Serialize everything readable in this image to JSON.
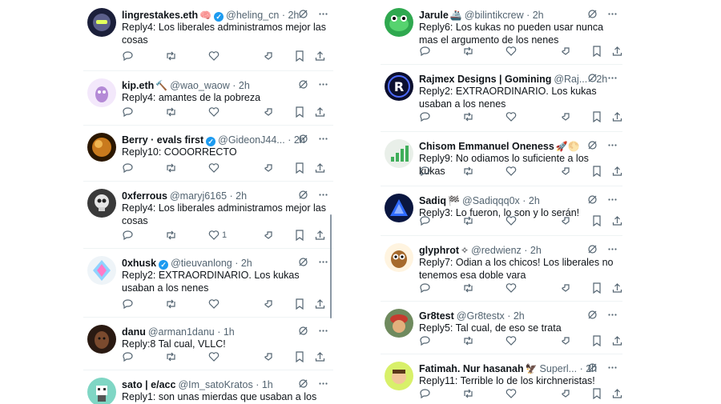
{
  "left_column": [
    {
      "name": "lingrestakes.eth",
      "emoji": "🧠",
      "verified": true,
      "handle": "@heling_cn",
      "time": "2h",
      "text": "Reply4: Los liberales administramos mejor las cosas",
      "likes": "",
      "avatar": "robot-avatar"
    },
    {
      "name": "kip.eth",
      "emoji": "🔨",
      "verified": false,
      "handle": "@wao_waow",
      "time": "2h",
      "text": "Reply4: amantes de la pobreza",
      "likes": "",
      "avatar": "purple-character-avatar"
    },
    {
      "name": "Berry · evals first",
      "emoji": "",
      "verified": true,
      "handle": "@GideonJ44...",
      "time": "2h",
      "text": "Reply10: COOORRECTO",
      "likes": "",
      "avatar": "planet-avatar"
    },
    {
      "name": "0xferrous",
      "emoji": "",
      "verified": false,
      "handle": "@maryj6165",
      "time": "2h",
      "text": "Reply4: Los liberales administramos mejor las cosas",
      "likes": "1",
      "avatar": "skull-avatar"
    },
    {
      "name": "0xhusk",
      "emoji": "",
      "verified": true,
      "handle": "@tieuvanlong",
      "time": "2h",
      "text": "Reply2: EXTRAORDINARIO. Los kukas usaban a los nenes",
      "likes": "",
      "avatar": "neon-face-avatar"
    },
    {
      "name": "danu",
      "emoji": "",
      "verified": false,
      "handle": "@arman1danu",
      "time": "1h",
      "text": "Reply:8 Tal cual, VLLC!",
      "likes": "",
      "avatar": "woman-portrait-avatar"
    },
    {
      "name": "sato | e/acc",
      "emoji": "",
      "verified": false,
      "handle": "@Im_satoKratos",
      "time": "1h",
      "text": "Reply1: son unas mierdas que usaban a los",
      "likes": "",
      "avatar": "pixel-robot-avatar"
    }
  ],
  "right_column": [
    {
      "name": "Jarule",
      "emoji": "🚢",
      "verified": false,
      "handle": "@bilintikcrew",
      "time": "2h",
      "text": "Reply6: Los kukas no pueden usar nunca mas el argumento de los nenes",
      "likes": "",
      "avatar": "green-frog-avatar"
    },
    {
      "name": "Rajmex Designs | Gomining",
      "emoji": "",
      "verified": false,
      "handle": "@Raj...",
      "time": "2h",
      "text": "Reply2: EXTRAORDINARIO. Los kukas usaban a los nenes",
      "likes": "",
      "avatar": "r-logo-avatar"
    },
    {
      "name": "Chisom Emmanuel Oneness",
      "emoji": "🚀🌕",
      "verified": false,
      "handle": "",
      "time": "",
      "text": "Reply9: No odiamos lo suficiente a los kukas",
      "likes": "",
      "avatar": "chart-avatar"
    },
    {
      "name": "Sadiq",
      "emoji": "🏁",
      "verified": false,
      "handle": "@Sadiqqq0x",
      "time": "2h",
      "text": "Reply3: Lo fueron, lo son y lo serán!",
      "likes": "",
      "avatar": "blue-triangle-avatar"
    },
    {
      "name": "glyphrot",
      "emoji": "✧",
      "verified": false,
      "handle": "@redwienz",
      "time": "2h",
      "text": "Reply7: Odian a los chicos! Los liberales no tenemos esa doble vara",
      "likes": "",
      "avatar": "owl-avatar"
    },
    {
      "name": "Gr8test",
      "emoji": "",
      "verified": false,
      "handle": "@Gr8testx",
      "time": "2h",
      "text": "Reply5: Tal cual, de eso se trata",
      "likes": "",
      "avatar": "soldier-avatar"
    },
    {
      "name": "Fatimah. Nur hasanah",
      "emoji": "🦅",
      "verified": false,
      "handle": "Superl...",
      "time": "2h",
      "text": "Reply11: Terrible lo de los kirchneristas!",
      "likes": "",
      "avatar": "cartoon-man-avatar"
    }
  ],
  "colors": {
    "text": "#0f1419",
    "muted": "#536471",
    "verified": "#1d9bf0",
    "divider": "#eff3f4"
  },
  "icons": [
    "reply-icon",
    "retweet-icon",
    "like-icon",
    "downvote-icon",
    "bookmark-icon",
    "share-icon",
    "grok-icon",
    "more-icon"
  ]
}
